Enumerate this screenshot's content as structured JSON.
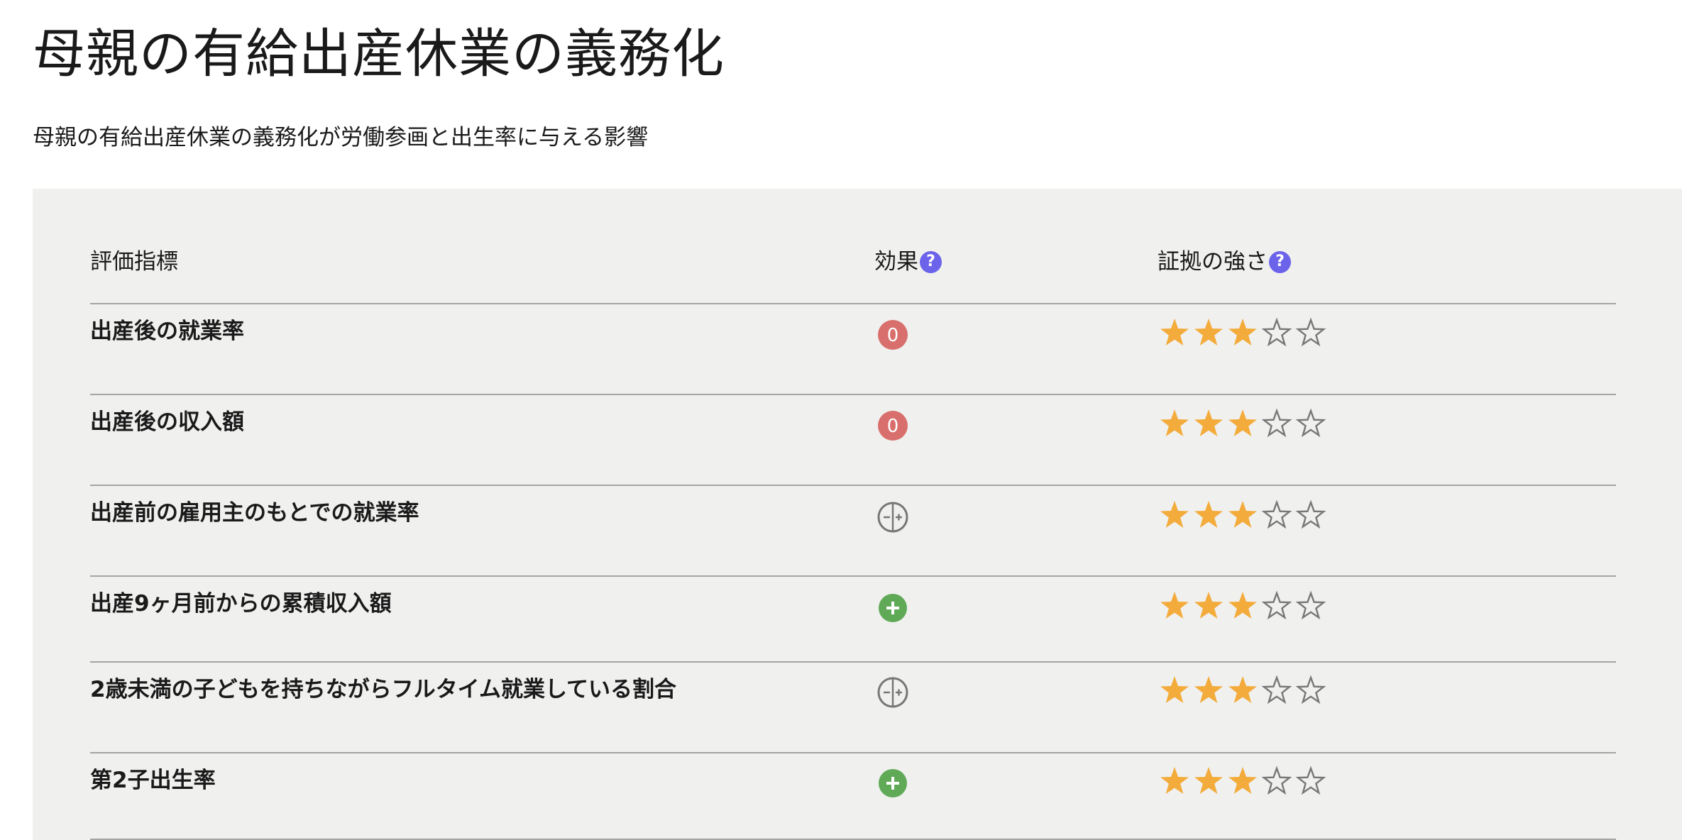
{
  "page": {
    "title": "母親の有給出産休業の義務化",
    "subtitle": "母親の有給出産休業の義務化が労働参画と出生率に与える影響"
  },
  "table": {
    "headers": {
      "metric": "評価指標",
      "effect": "効果",
      "effect_help": "?",
      "evidence": "証拠の強さ",
      "evidence_help": "?"
    },
    "rows": [
      {
        "metric": "出産後の就業率",
        "effect": "no-effect",
        "effect_text": "0",
        "evidence_stars": 3,
        "max_stars": 5
      },
      {
        "metric": "出産後の収入額",
        "effect": "no-effect",
        "effect_text": "0",
        "evidence_stars": 3,
        "max_stars": 5
      },
      {
        "metric": "出産前の雇用主のもとでの就業率",
        "effect": "mixed",
        "effect_text": "",
        "evidence_stars": 3,
        "max_stars": 5
      },
      {
        "metric": "出産9ヶ月前からの累積収入額",
        "effect": "positive",
        "effect_text": "",
        "evidence_stars": 3,
        "max_stars": 5
      },
      {
        "metric": "2歳未満の子どもを持ちながらフルタイム就業している割合",
        "effect": "mixed",
        "effect_text": "",
        "evidence_stars": 3,
        "max_stars": 5
      },
      {
        "metric": "第2子出生率",
        "effect": "positive",
        "effect_text": "",
        "evidence_stars": 3,
        "max_stars": 5
      }
    ]
  },
  "colors": {
    "no_effect": "#d86f6c",
    "positive": "#5fa957",
    "mixed": "#777777",
    "star_filled": "#f3ac3c",
    "star_empty": "#777777",
    "help": "#6b63ea",
    "panel": "#f0f0ef"
  },
  "icons": {
    "no_effect": "zero-circle-icon",
    "positive": "plus-circle-icon",
    "mixed": "plus-minus-circle-icon",
    "star_filled": "star-filled-icon",
    "star_empty": "star-outline-icon",
    "help": "question-circle-icon"
  }
}
